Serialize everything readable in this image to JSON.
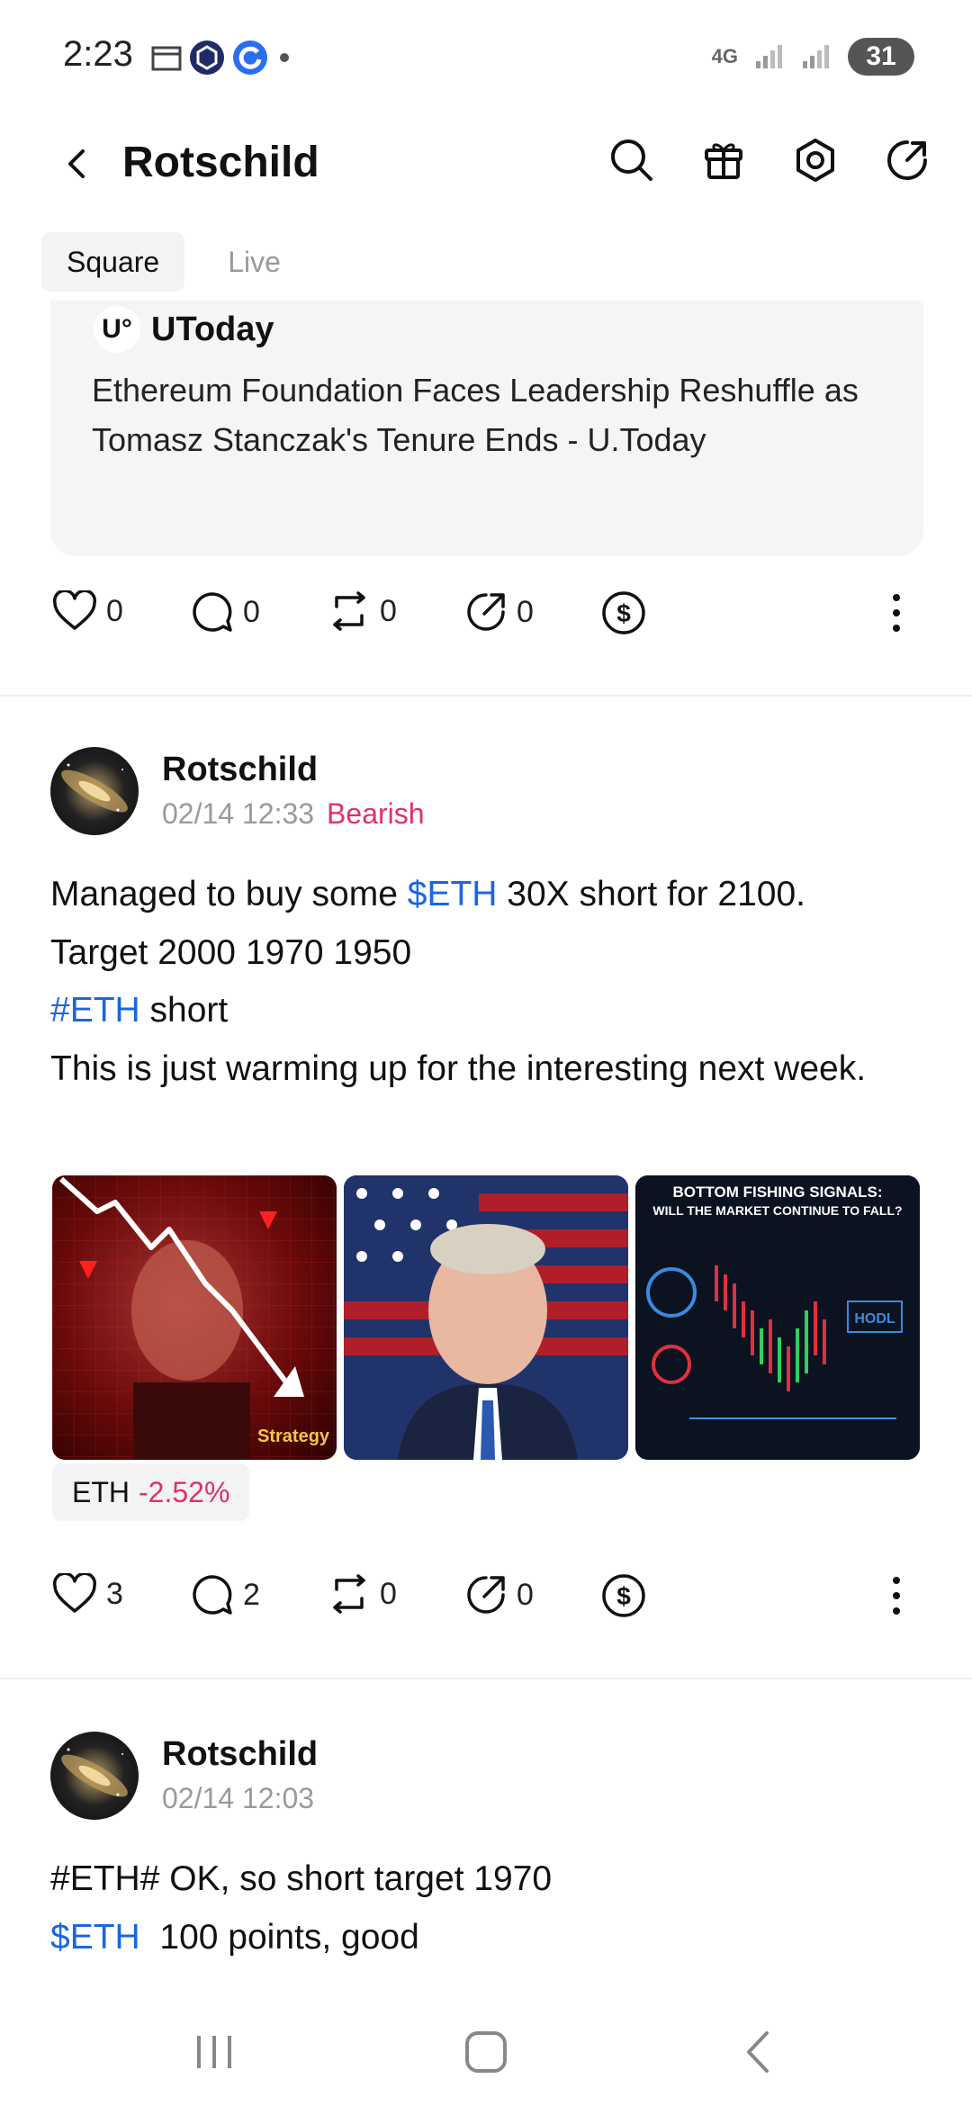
{
  "status_bar": {
    "time": "2:23",
    "network": "4G",
    "battery": "31"
  },
  "header": {
    "title": "Rotschild"
  },
  "tabs": [
    {
      "label": "Square",
      "active": true
    },
    {
      "label": "Live",
      "active": false
    }
  ],
  "news_card": {
    "source": "UToday",
    "logo_text": "U°",
    "text": "Ethereum Foundation Faces Leadership Reshuffle as Tomasz Stanczak's Tenure Ends - U.Today"
  },
  "news_actions": {
    "likes": "0",
    "comments": "0",
    "reposts": "0",
    "shares": "0"
  },
  "post1": {
    "author": "Rotschild",
    "time": "02/14 12:33",
    "sentiment": "Bearish",
    "line1_pre": "Managed to buy some ",
    "line1_tag": "$ETH",
    "line1_post": " 30X short for 2100.",
    "line2": "Target 2000 1970 1950",
    "line3_tag": "#ETH",
    "line3_post": " short",
    "line4": "This is just warming up for the interesting  next week.",
    "image3_title": "BOTTOM FISHING SIGNALS: WILL THE MARKET CONTINUE TO FALL?",
    "image3_label": "HODL",
    "image1_label": "Strategy",
    "chip_symbol": "ETH",
    "chip_change": "-2.52%",
    "actions": {
      "likes": "3",
      "comments": "2",
      "reposts": "0",
      "shares": "0"
    }
  },
  "post2": {
    "author": "Rotschild",
    "time": "02/14 12:03",
    "line1": "#ETH# OK, so short target 1970",
    "line2_tag": "$ETH",
    "line2_post": "  100 points, good"
  },
  "colors": {
    "accent_blue": "#1a66e0",
    "bearish_red": "#e0306a"
  }
}
